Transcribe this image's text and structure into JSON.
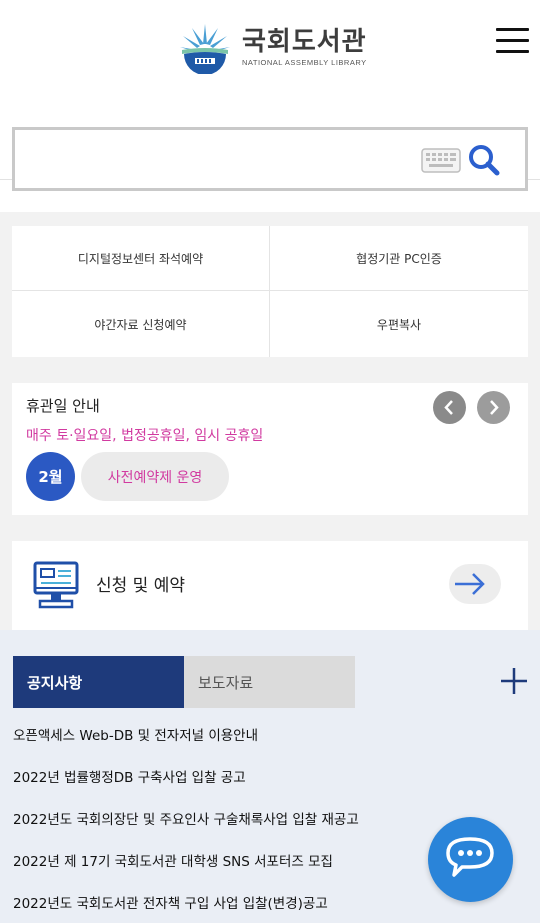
{
  "header": {
    "logo_title": "국회도서관",
    "logo_subtitle": "NATIONAL ASSEMBLY LIBRARY"
  },
  "search": {
    "placeholder": "",
    "value": ""
  },
  "quick_menu": [
    {
      "label": "디지털정보센터 좌석예약"
    },
    {
      "label": "협정기관 PC인증"
    },
    {
      "label": "야간자료 신청예약"
    },
    {
      "label": "우편복사"
    }
  ],
  "closed_days": {
    "title": "휴관일 안내",
    "description": "매주 토·일요일, 법정공휴일, 임시 공휴일",
    "month": "2월",
    "notice": "사전예약제 운영"
  },
  "apply": {
    "label": "신청 및 예약"
  },
  "board": {
    "tabs": [
      {
        "label": "공지사항",
        "active": true
      },
      {
        "label": "보도자료",
        "active": false
      }
    ],
    "items": [
      "오픈액세스 Web-DB 및 전자저널 이용안내",
      "2022년 법률행정DB 구축사업 입찰 공고",
      "2022년도 국회의장단 및 주요인사 구술채록사업 입찰 재공고",
      "2022년 제 17기 국회도서관 대학생 SNS 서포터즈 모집",
      "2022년도 국회도서관 전자책 구입 사업 입찰(변경)공고"
    ]
  },
  "colors": {
    "primary_navy": "#1e3a7b",
    "badge_blue": "#2b59c3",
    "accent_pink": "#d13aa0",
    "chat_blue": "#2a84d9"
  },
  "icons": [
    "menu-icon",
    "keyboard-icon",
    "search-icon",
    "chevron-left-icon",
    "chevron-right-icon",
    "monitor-icon",
    "arrow-right-icon",
    "plus-icon",
    "chat-icon"
  ]
}
